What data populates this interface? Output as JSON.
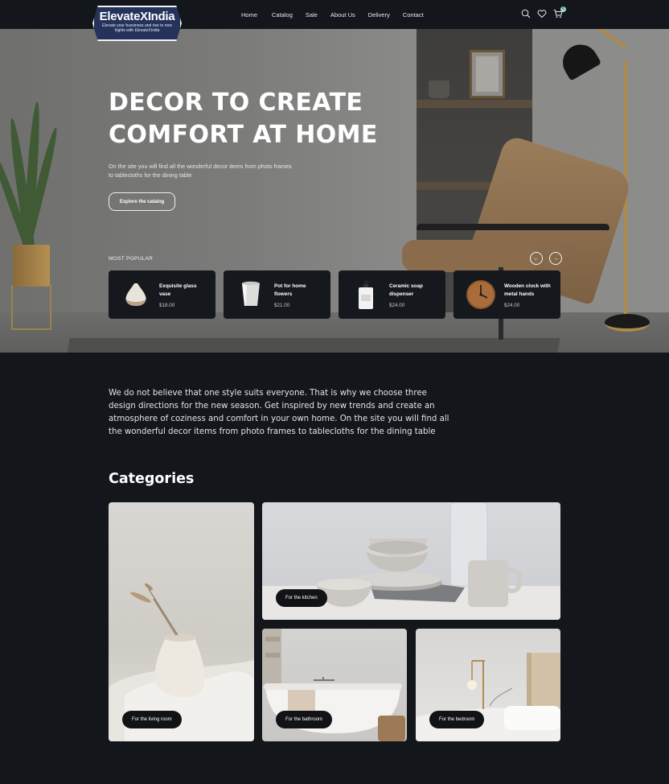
{
  "brand": {
    "name": "ElevateXIndia",
    "tagline": "Elevate your bussiness and rise to new hights with ElevateXIndia"
  },
  "nav": {
    "items": [
      "Home",
      "Catalog",
      "Sale",
      "About Us",
      "Delivery",
      "Contact"
    ]
  },
  "header_icons": [
    "search-icon",
    "heart-icon",
    "cart-icon"
  ],
  "cart": {
    "count": "0"
  },
  "hero": {
    "title": "DECOR TO CREATE COMFORT AT HOME",
    "subtitle": "On the site you will find all the wonderful decor items from photo frames to tablecloths for the dining table",
    "cta_label": "Explore the catalog",
    "popular_label": "MOST POPULAR",
    "prev_arrow": "←",
    "next_arrow": "→",
    "products": [
      {
        "name": "Exquisite glass vase",
        "price": "$18.00",
        "icon": "vase"
      },
      {
        "name": "Pot for home flowers",
        "price": "$21.00",
        "icon": "pot"
      },
      {
        "name": "Ceramic soap dispenser",
        "price": "$24.00",
        "icon": "soap-dispenser"
      },
      {
        "name": "Wooden clock with metal hands",
        "price": "$24.00",
        "icon": "clock"
      }
    ]
  },
  "intro": {
    "text": "We do not believe that one style suits everyone. That is why we choose three design directions for the new season. Get inspired by new trends and create an atmosphere of coziness and comfort in your own home. On the site you will find all the wonderful decor items from photo frames to tablecloths for the dining table"
  },
  "categories": {
    "title": "Categories",
    "items": [
      {
        "label": "For the living room"
      },
      {
        "label": "For the kitchen"
      },
      {
        "label": "For the bathroom"
      },
      {
        "label": "For the bedroom"
      }
    ]
  },
  "colors": {
    "background": "#13161b",
    "card": "#15181d",
    "pill": "#111317",
    "cart_badge": "#a0d8cf",
    "logo_bg": "#24325c"
  }
}
